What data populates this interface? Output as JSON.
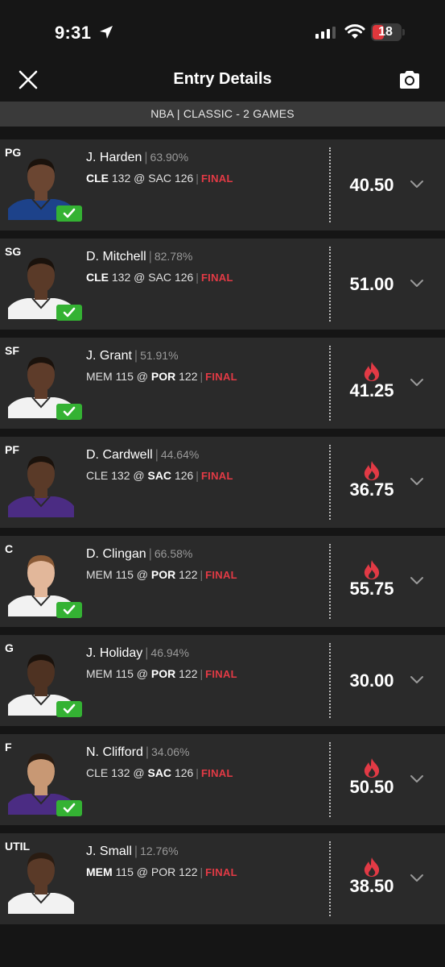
{
  "status_bar": {
    "time": "9:31",
    "battery": "18"
  },
  "header": {
    "title": "Entry Details"
  },
  "contest": {
    "label": "NBA | CLASSIC - 2 GAMES"
  },
  "players": [
    {
      "pos": "PG",
      "name": "J. Harden",
      "pct": "63.90%",
      "away": "CLE",
      "away_score": "132",
      "at": "@",
      "home": "SAC",
      "home_score": "126",
      "bold": "away",
      "status": "FINAL",
      "points": "40.50",
      "hot": false,
      "checked": true,
      "skin": "#6b4632",
      "jersey": "#1d428a",
      "hair": "#1a120c"
    },
    {
      "pos": "SG",
      "name": "D. Mitchell",
      "pct": "82.78%",
      "away": "CLE",
      "away_score": "132",
      "at": "@",
      "home": "SAC",
      "home_score": "126",
      "bold": "away",
      "status": "FINAL",
      "points": "51.00",
      "hot": false,
      "checked": true,
      "skin": "#5a3a28",
      "jersey": "#f2f2f2",
      "hair": "#1a120c"
    },
    {
      "pos": "SF",
      "name": "J. Grant",
      "pct": "51.91%",
      "away": "MEM",
      "away_score": "115",
      "at": "@",
      "home": "POR",
      "home_score": "122",
      "bold": "home",
      "status": "FINAL",
      "points": "41.25",
      "hot": true,
      "checked": true,
      "skin": "#5e3c2a",
      "jersey": "#f2f2f2",
      "hair": "#1a120c"
    },
    {
      "pos": "PF",
      "name": "D. Cardwell",
      "pct": "44.64%",
      "away": "CLE",
      "away_score": "132",
      "at": "@",
      "home": "SAC",
      "home_score": "126",
      "bold": "home",
      "status": "FINAL",
      "points": "36.75",
      "hot": true,
      "checked": false,
      "skin": "#5a3a28",
      "jersey": "#4b2c83",
      "hair": "#1a120c"
    },
    {
      "pos": "C",
      "name": "D. Clingan",
      "pct": "66.58%",
      "away": "MEM",
      "away_score": "115",
      "at": "@",
      "home": "POR",
      "home_score": "122",
      "bold": "home",
      "status": "FINAL",
      "points": "55.75",
      "hot": true,
      "checked": true,
      "skin": "#e2b79a",
      "jersey": "#f2f2f2",
      "hair": "#8a5a36"
    },
    {
      "pos": "G",
      "name": "J. Holiday",
      "pct": "46.94%",
      "away": "MEM",
      "away_score": "115",
      "at": "@",
      "home": "POR",
      "home_score": "122",
      "bold": "home",
      "status": "FINAL",
      "points": "30.00",
      "hot": false,
      "checked": true,
      "skin": "#4e3222",
      "jersey": "#f2f2f2",
      "hair": "#1a120c"
    },
    {
      "pos": "F",
      "name": "N. Clifford",
      "pct": "34.06%",
      "away": "CLE",
      "away_score": "132",
      "at": "@",
      "home": "SAC",
      "home_score": "126",
      "bold": "home",
      "status": "FINAL",
      "points": "50.50",
      "hot": true,
      "checked": true,
      "skin": "#c89874",
      "jersey": "#4b2c83",
      "hair": "#2a1c12"
    },
    {
      "pos": "UTIL",
      "name": "J. Small",
      "pct": "12.76%",
      "away": "MEM",
      "away_score": "115",
      "at": "@",
      "home": "POR",
      "home_score": "122",
      "bold": "away",
      "status": "FINAL",
      "points": "38.50",
      "hot": true,
      "checked": false,
      "skin": "#5a3a28",
      "jersey": "#f2f2f2",
      "hair": "#2a1c12"
    }
  ],
  "icons": {
    "close": "close-icon",
    "camera": "camera-icon",
    "expand": "chevron-down-icon",
    "hot": "fire-icon",
    "check": "checkmark-icon"
  },
  "colors": {
    "final": "#e23a45",
    "fire": "#e23a45",
    "check": "#34b233",
    "card": "#2a2a2a",
    "background": "#151515"
  }
}
